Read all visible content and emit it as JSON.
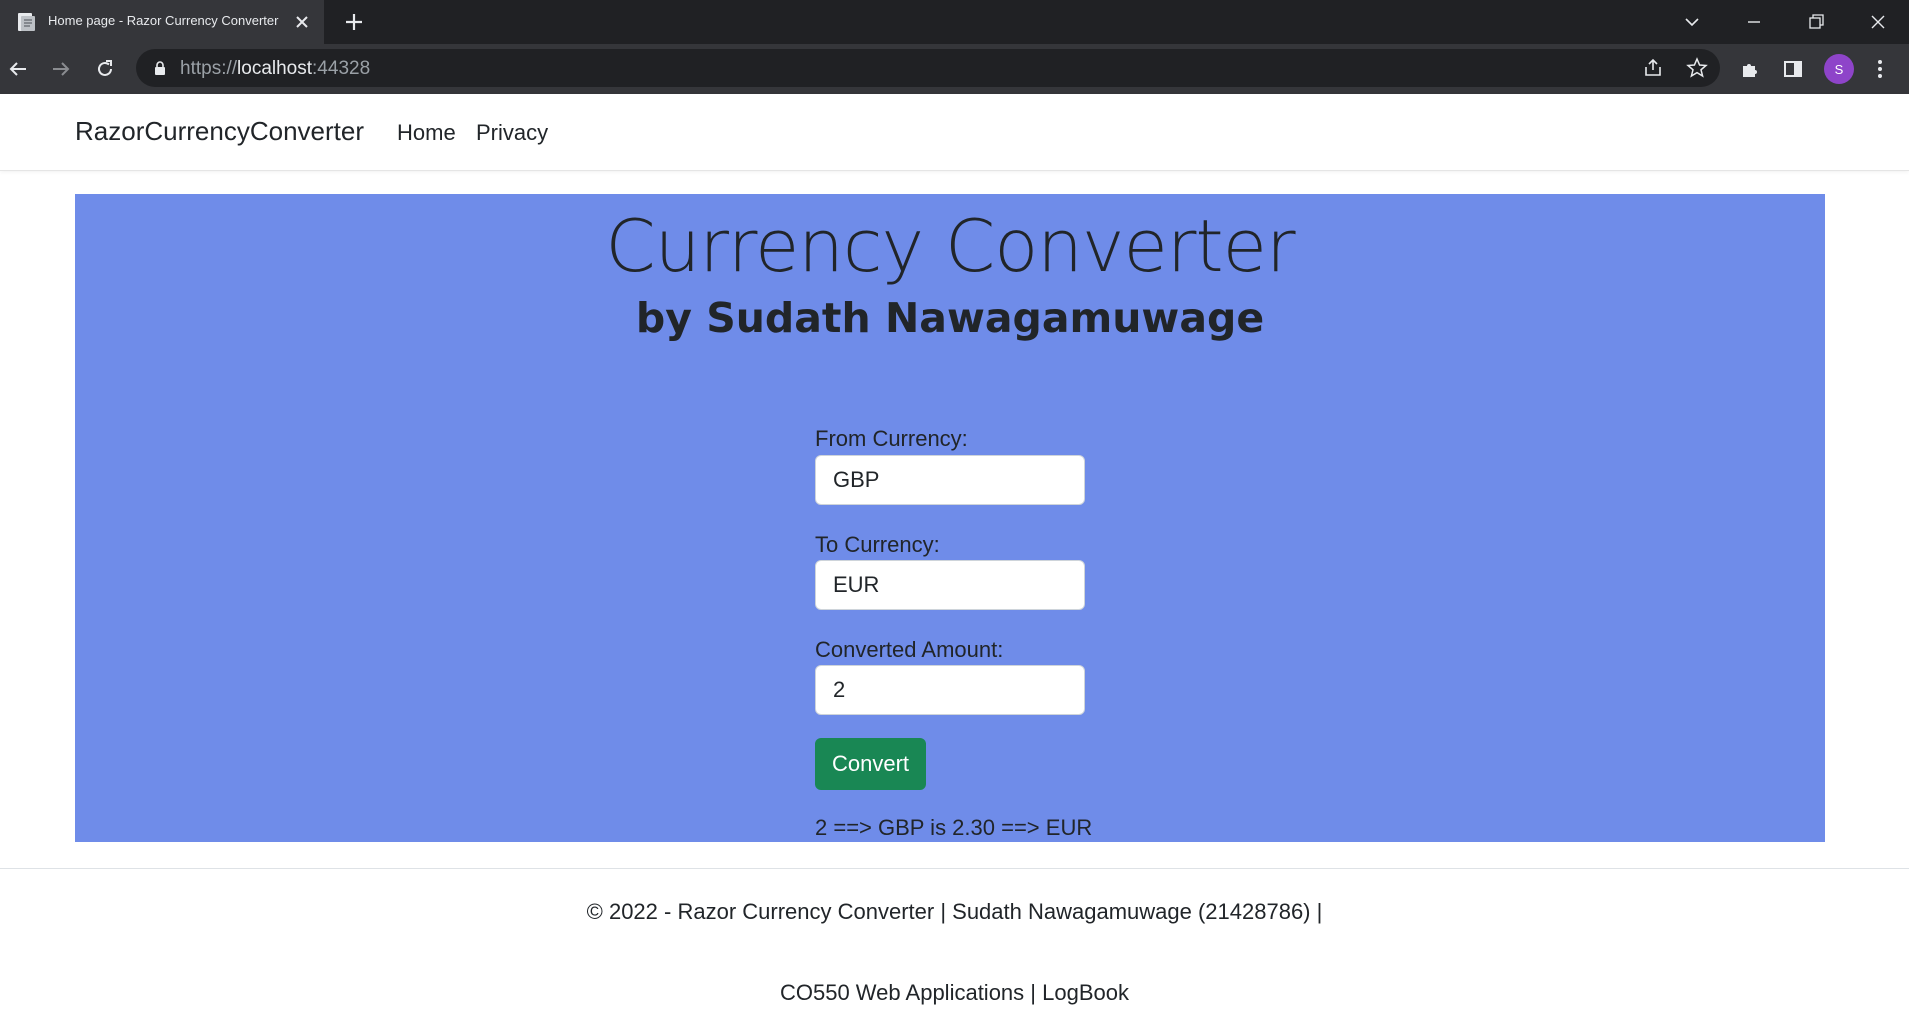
{
  "browser": {
    "tab_title": "Home page - Razor Currency Converter",
    "url_scheme": "https://",
    "url_host": "localhost",
    "url_port": ":44328",
    "profile_initial": "S"
  },
  "nav": {
    "brand": "RazorCurrencyConverter",
    "links": [
      "Home",
      "Privacy"
    ]
  },
  "hero": {
    "title": "Currency Converter",
    "subtitle": "by Sudath Nawagamuwage"
  },
  "form": {
    "from_label": "From Currency:",
    "from_value": "GBP",
    "to_label": "To Currency:",
    "to_value": "EUR",
    "amount_label": "Converted Amount:",
    "amount_value": "2",
    "button_label": "Convert",
    "result": "2 ==> GBP is 2.30 ==> EUR"
  },
  "footer": {
    "copyright": "© 2022 - Razor Currency Converter | Sudath Nawagamuwage (21428786) |",
    "course_link": "CO550 Web Applications",
    "separator": "|",
    "logbook_link": "LogBook"
  },
  "colors": {
    "hero_bg": "#6f8ce9",
    "button_bg": "#198754",
    "avatar_bg": "#8e44c9"
  }
}
